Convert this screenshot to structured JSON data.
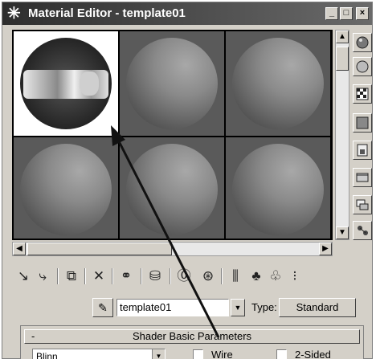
{
  "window": {
    "title": "Material Editor - template01",
    "title_icon": "snowflake-icon",
    "minimize_label": "_",
    "maximize_label": "□",
    "close_label": "×"
  },
  "slots": [
    {
      "name": "slot-1",
      "active": true
    },
    {
      "name": "slot-2",
      "active": false
    },
    {
      "name": "slot-3",
      "active": false
    },
    {
      "name": "slot-4",
      "active": false
    },
    {
      "name": "slot-5",
      "active": false
    },
    {
      "name": "slot-6",
      "active": false
    }
  ],
  "right_toolbar": [
    "sample-type-icon",
    "backlight-icon",
    "background-icon",
    "uv-tiling-icon",
    "video-color-check-icon",
    "make-preview-icon",
    "options-icon",
    "select-by-material-icon"
  ],
  "bottom_toolbar": [
    "get-material-icon",
    "put-to-scene-icon",
    "assign-material-icon",
    "reset-map-icon",
    "copy-material-icon",
    "make-unique-icon",
    "put-to-library-icon",
    "material-effects-channel-icon",
    "show-map-in-viewport-icon",
    "show-end-result-icon",
    "go-to-parent-icon",
    "go-forward-icon",
    "material-navigator-icon"
  ],
  "material": {
    "picker_icon": "eyedropper-icon",
    "name": "template01",
    "type_label": "Type:",
    "type_value": "Standard"
  },
  "rollout": {
    "toggle": "-",
    "title": "Shader Basic Parameters",
    "shader_value": "Blinn",
    "wire_label": "Wire",
    "two_sided_label": "2-Sided"
  }
}
